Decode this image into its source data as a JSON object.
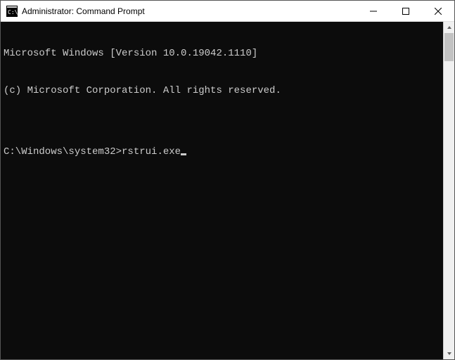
{
  "window": {
    "title": "Administrator: Command Prompt"
  },
  "terminal": {
    "header_line_1": "Microsoft Windows [Version 10.0.19042.1110]",
    "header_line_2": "(c) Microsoft Corporation. All rights reserved.",
    "blank": "",
    "prompt": "C:\\Windows\\system32>",
    "command": "rstrui.exe"
  }
}
